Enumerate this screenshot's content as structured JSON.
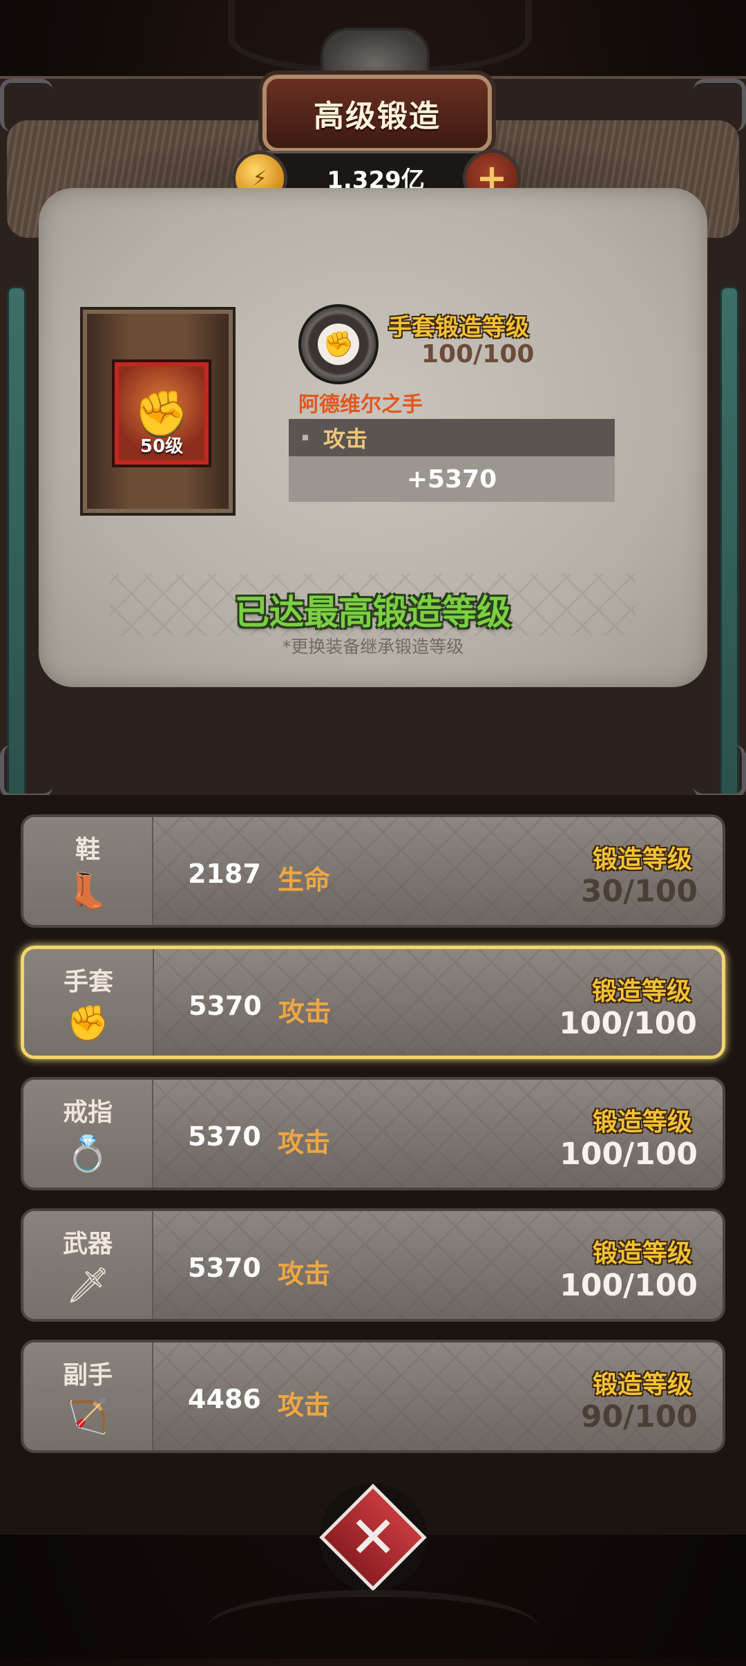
{
  "header": {
    "title": "高级锻造",
    "currency_amount": "1.329亿"
  },
  "icons": {
    "coin": "coin-icon",
    "plus": "plus-icon",
    "fist": "fist-icon",
    "close": "close-x-icon"
  },
  "equipment": {
    "level_badge": "50级",
    "forge_level_label": "手套锻造等级",
    "forge_level_value": "100/100",
    "item_name": "阿德维尔之手",
    "stat_name": "攻击",
    "stat_value": "+5370"
  },
  "status": {
    "max_message": "已达最高锻造等级",
    "hint": "*更换装备继承锻造等级"
  },
  "slots": [
    {
      "name": "鞋",
      "icon": "boot-icon",
      "amount": "2187",
      "stat": "生命",
      "forge_label": "锻造等级",
      "forge_value": "30/100",
      "selected": false
    },
    {
      "name": "手套",
      "icon": "glove-icon",
      "amount": "5370",
      "stat": "攻击",
      "forge_label": "锻造等级",
      "forge_value": "100/100",
      "selected": true
    },
    {
      "name": "戒指",
      "icon": "ring-icon",
      "amount": "5370",
      "stat": "攻击",
      "forge_label": "锻造等级",
      "forge_value": "100/100",
      "selected": false
    },
    {
      "name": "武器",
      "icon": "sword-icon",
      "amount": "5370",
      "stat": "攻击",
      "forge_label": "锻造等级",
      "forge_value": "100/100",
      "selected": false
    },
    {
      "name": "副手",
      "icon": "bow-icon",
      "amount": "4486",
      "stat": "攻击",
      "forge_label": "锻造等级",
      "forge_value": "90/100",
      "selected": false
    }
  ],
  "colors": {
    "gold_label": "#f4c233",
    "green_max": "#7bd042",
    "item_name_orange": "#e2571f",
    "stat_orange": "#f0a743",
    "selected_border": "#f0d76a"
  }
}
